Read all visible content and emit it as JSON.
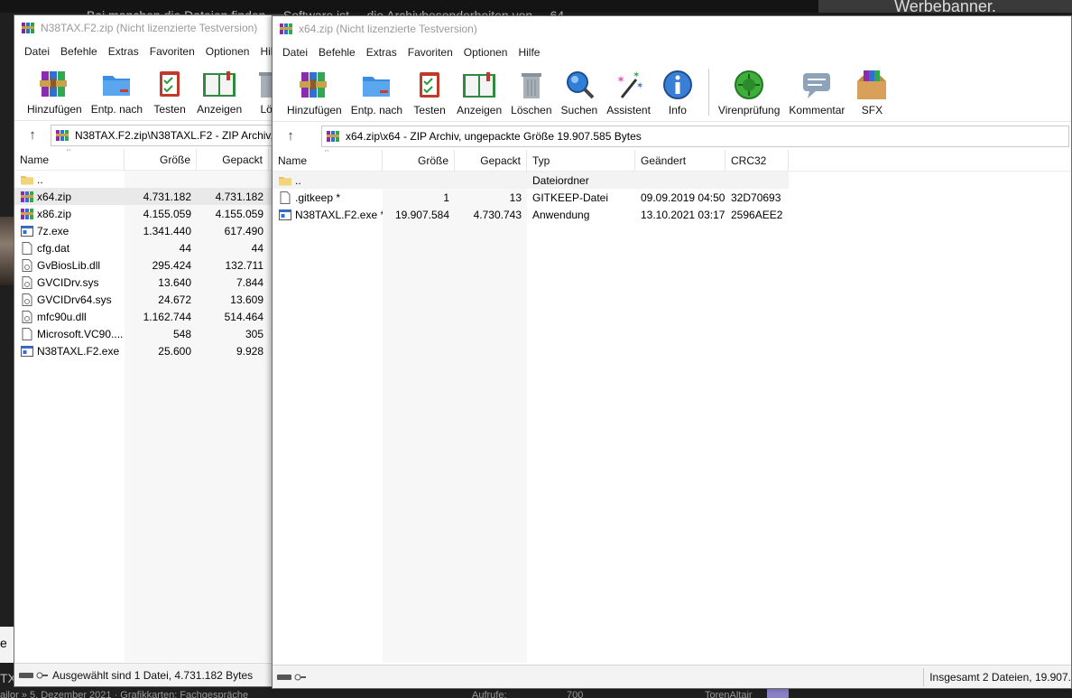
{
  "background": {
    "ad_text": "Werbebanner.",
    "top_fragment": "Bei manchen die Dateien finden ... Software ist ... die Archivbesonderheiten von ... 64",
    "left_fragment": "e T",
    "left_fragment2": "TX",
    "bottom_left": "ailor » 5. Dezember 2021 · Grafikkarten: Fachgespräche",
    "bottom_views_label": "Aufrufe:",
    "bottom_views_value": "700",
    "bottom_user": "TorenAltair"
  },
  "window1": {
    "title": "N38TAX.F2.zip (Nicht lizenzierte Testversion)",
    "menu": [
      "Datei",
      "Befehle",
      "Extras",
      "Favoriten",
      "Optionen",
      "Hilfe"
    ],
    "toolbar": [
      {
        "label": "Hinzufügen",
        "icon": "add-archive-icon"
      },
      {
        "label": "Entp. nach",
        "icon": "extract-folder-icon"
      },
      {
        "label": "Testen",
        "icon": "test-checklist-icon"
      },
      {
        "label": "Anzeigen",
        "icon": "view-book-icon"
      },
      {
        "label": "Lös",
        "icon": "delete-trash-icon"
      }
    ],
    "address": "N38TAX.F2.zip\\N38TAXL.F2 - ZIP Archiv,",
    "columns": [
      "Name",
      "Größe",
      "Gepackt"
    ],
    "rows": [
      {
        "name": "..",
        "size": "",
        "packed": "",
        "icon": "folder-icon"
      },
      {
        "name": "x64.zip",
        "size": "4.731.182",
        "packed": "4.731.182",
        "icon": "winrar-icon",
        "selected": true
      },
      {
        "name": "x86.zip",
        "size": "4.155.059",
        "packed": "4.155.059",
        "icon": "winrar-icon"
      },
      {
        "name": "7z.exe",
        "size": "1.341.440",
        "packed": "617.490",
        "icon": "exe-icon"
      },
      {
        "name": "cfg.dat",
        "size": "44",
        "packed": "44",
        "icon": "file-icon"
      },
      {
        "name": "GvBiosLib.dll",
        "size": "295.424",
        "packed": "132.711",
        "icon": "dll-icon"
      },
      {
        "name": "GVCIDrv.sys",
        "size": "13.640",
        "packed": "7.844",
        "icon": "sys-icon"
      },
      {
        "name": "GVCIDrv64.sys",
        "size": "24.672",
        "packed": "13.609",
        "icon": "sys-icon"
      },
      {
        "name": "mfc90u.dll",
        "size": "1.162.744",
        "packed": "514.464",
        "icon": "dll-icon"
      },
      {
        "name": "Microsoft.VC90....",
        "size": "548",
        "packed": "305",
        "icon": "file-icon"
      },
      {
        "name": "N38TAXL.F2.exe",
        "size": "25.600",
        "packed": "9.928",
        "icon": "exe-icon"
      }
    ],
    "status": "Ausgewählt sind 1 Datei, 4.731.182 Bytes"
  },
  "window2": {
    "title": "x64.zip (Nicht lizenzierte Testversion)",
    "menu": [
      "Datei",
      "Befehle",
      "Extras",
      "Favoriten",
      "Optionen",
      "Hilfe"
    ],
    "toolbar": [
      {
        "label": "Hinzufügen",
        "icon": "add-archive-icon"
      },
      {
        "label": "Entp. nach",
        "icon": "extract-folder-icon"
      },
      {
        "label": "Testen",
        "icon": "test-checklist-icon"
      },
      {
        "label": "Anzeigen",
        "icon": "view-book-icon"
      },
      {
        "label": "Löschen",
        "icon": "delete-trash-icon"
      },
      {
        "label": "Suchen",
        "icon": "search-magnifier-icon"
      },
      {
        "label": "Assistent",
        "icon": "wizard-wand-icon"
      },
      {
        "label": "Info",
        "icon": "info-icon"
      },
      {
        "label": "Virenprüfung",
        "icon": "virus-scan-icon"
      },
      {
        "label": "Kommentar",
        "icon": "comment-icon"
      },
      {
        "label": "SFX",
        "icon": "sfx-box-icon"
      }
    ],
    "address": "x64.zip\\x64 - ZIP Archiv, ungepackte Größe 19.907.585 Bytes",
    "columns": [
      "Name",
      "Größe",
      "Gepackt",
      "Typ",
      "Geändert",
      "CRC32"
    ],
    "rows": [
      {
        "name": "..",
        "size": "",
        "packed": "",
        "type": "Dateiordner",
        "modified": "",
        "crc": "",
        "icon": "folder-icon"
      },
      {
        "name": ".gitkeep *",
        "size": "1",
        "packed": "13",
        "type": "GITKEEP-Datei",
        "modified": "09.09.2019 04:50",
        "crc": "32D70693",
        "icon": "file-icon"
      },
      {
        "name": "N38TAXL.F2.exe *",
        "size": "19.907.584",
        "packed": "4.730.743",
        "type": "Anwendung",
        "modified": "13.10.2021 03:17",
        "crc": "2596AEE2",
        "icon": "exe-icon"
      }
    ],
    "status": "Insgesamt 2 Dateien, 19.907."
  },
  "colors": {
    "window_bg": "#ffffff",
    "selection_bg": "#e9e9e9",
    "column_shade": "#f7f7f7",
    "page_bg": "#1f1f1f"
  }
}
